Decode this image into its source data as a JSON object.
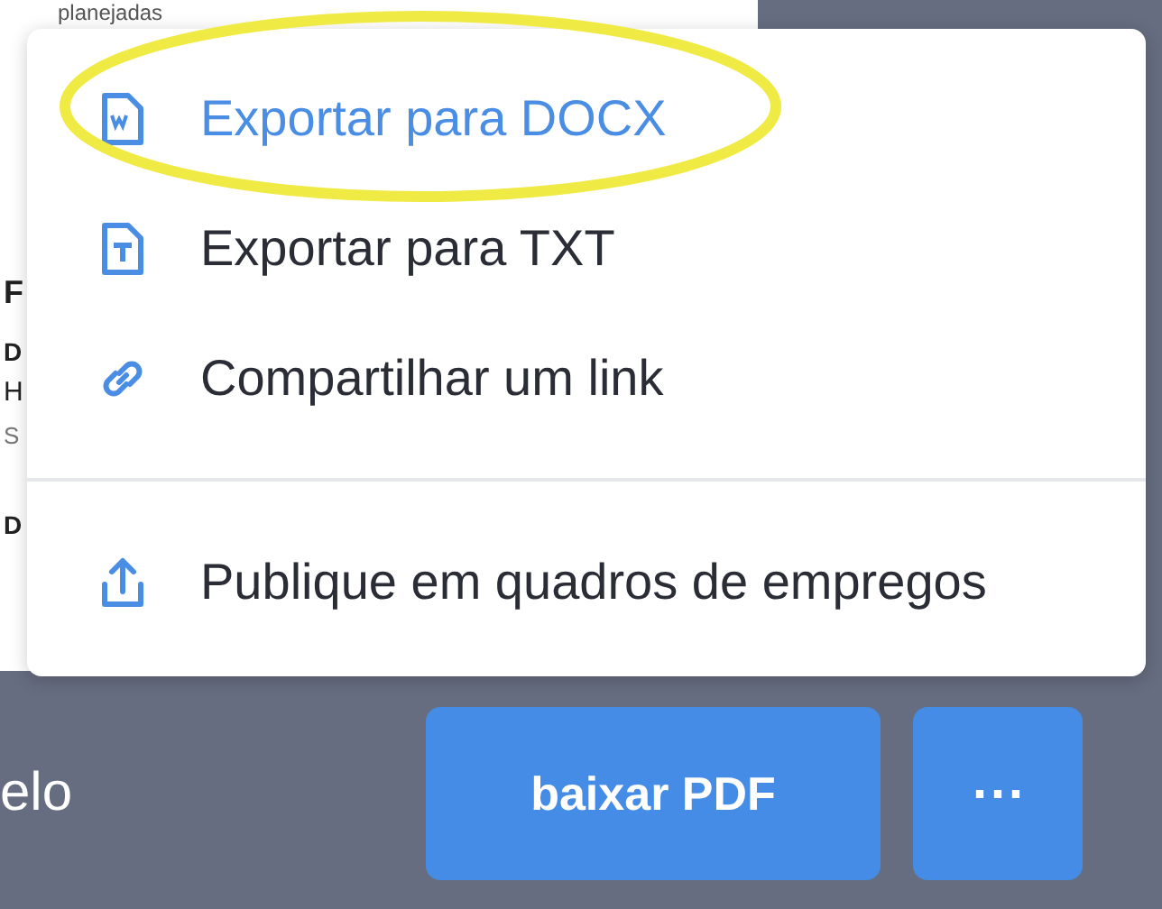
{
  "document": {
    "lines": [
      {
        "text": "planejadas",
        "kind": "small"
      },
      {
        "text": "F",
        "kind": "heading"
      },
      {
        "text": "D",
        "kind": "bold"
      },
      {
        "text": "H",
        "kind": "plain"
      },
      {
        "text": "S",
        "kind": "muted"
      },
      {
        "text": "D",
        "kind": "bold"
      }
    ]
  },
  "menu": {
    "items": [
      {
        "label": "Exportar para DOCX",
        "kind": "docx",
        "selected": true
      },
      {
        "label": "Exportar para TXT",
        "kind": "txt",
        "selected": false
      },
      {
        "label": "Compartilhar um link",
        "kind": "link",
        "selected": false
      },
      {
        "label": "Publique em quadros de empregos",
        "kind": "upload",
        "selected": false,
        "divider_before": true
      }
    ]
  },
  "footer": {
    "text": "elo",
    "buttons": [
      {
        "label": "baixar PDF",
        "kind": "primary"
      },
      {
        "label": "⋯",
        "kind": "more"
      }
    ]
  }
}
